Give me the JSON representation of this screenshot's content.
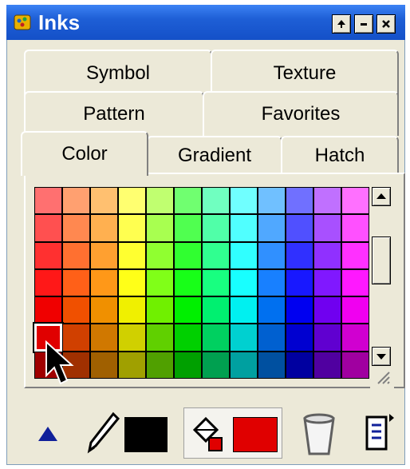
{
  "window": {
    "title": "Inks",
    "titlebar_buttons": [
      "pin-button",
      "minimize-button",
      "close-button"
    ]
  },
  "tabs": {
    "row1": [
      "Symbol",
      "Texture"
    ],
    "row2": [
      "Pattern",
      "Favorites"
    ],
    "row3": [
      "Color",
      "Gradient",
      "Hatch"
    ],
    "active": "Color"
  },
  "palette": {
    "rows": [
      [
        "#ff7070",
        "#ffa070",
        "#ffc070",
        "#ffff70",
        "#c0ff70",
        "#70ff70",
        "#70ffc0",
        "#70ffff",
        "#70c0ff",
        "#7070ff",
        "#c070ff",
        "#ff70ff"
      ],
      [
        "#ff5050",
        "#ff8850",
        "#ffb050",
        "#ffff50",
        "#a8ff50",
        "#50ff50",
        "#50ffa8",
        "#50ffff",
        "#50a8ff",
        "#5050ff",
        "#a850ff",
        "#ff50ff"
      ],
      [
        "#ff3030",
        "#ff7030",
        "#ffa030",
        "#ffff30",
        "#90ff30",
        "#30ff30",
        "#30ff90",
        "#30ffff",
        "#3090ff",
        "#3030ff",
        "#9030ff",
        "#ff30ff"
      ],
      [
        "#ff1818",
        "#ff6018",
        "#ff9818",
        "#ffff18",
        "#80ff18",
        "#18ff18",
        "#18ff80",
        "#18ffff",
        "#1880ff",
        "#1818ff",
        "#8018ff",
        "#ff18ff"
      ],
      [
        "#f00000",
        "#f05000",
        "#f09000",
        "#f0f000",
        "#70f000",
        "#00f000",
        "#00f070",
        "#00f0f0",
        "#0070f0",
        "#0000f0",
        "#7000f0",
        "#f000f0"
      ],
      [
        "#d00000",
        "#d04000",
        "#d07800",
        "#d0d000",
        "#60d000",
        "#00d000",
        "#00d060",
        "#00d0d0",
        "#0060d0",
        "#0000d0",
        "#6000d0",
        "#d000d0"
      ],
      [
        "#a00000",
        "#a03000",
        "#a06000",
        "#a0a000",
        "#50a000",
        "#00a000",
        "#00a050",
        "#00a0a0",
        "#0050a0",
        "#0000a0",
        "#5000a0",
        "#a000a0"
      ]
    ],
    "selected_color": "#e00000"
  },
  "toolbar": {
    "pen_color": "#000000",
    "fill_color": "#e00000",
    "icons": [
      "up-triangle-icon",
      "pen-icon",
      "fill-bucket-icon",
      "trash-can-icon",
      "menu-icon"
    ]
  }
}
